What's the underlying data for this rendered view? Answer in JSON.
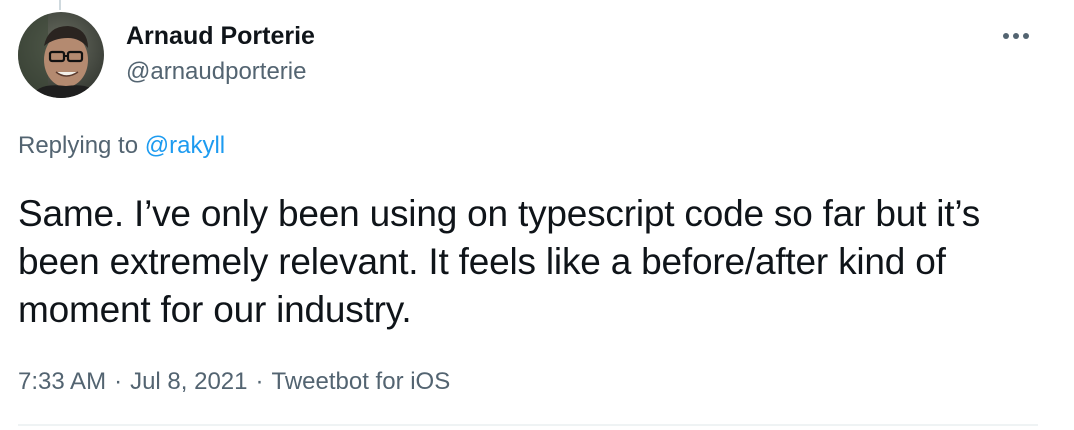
{
  "author": {
    "display_name": "Arnaud Porterie",
    "handle": "@arnaudporterie"
  },
  "reply": {
    "prefix": "Replying to ",
    "to_handle": "@rakyll"
  },
  "tweet_text": "Same. I’ve only been using on typescript code so far but it’s been extremely relevant. It feels like a before/after kind of moment for our industry.",
  "meta": {
    "time": "7:33 AM",
    "separator": "·",
    "date": "Jul 8, 2021",
    "source": "Tweetbot for iOS"
  },
  "icons": {
    "more": "more-horizontal-icon"
  },
  "colors": {
    "text_primary": "#0f1419",
    "text_secondary": "#536471",
    "link": "#1d9bf0"
  }
}
